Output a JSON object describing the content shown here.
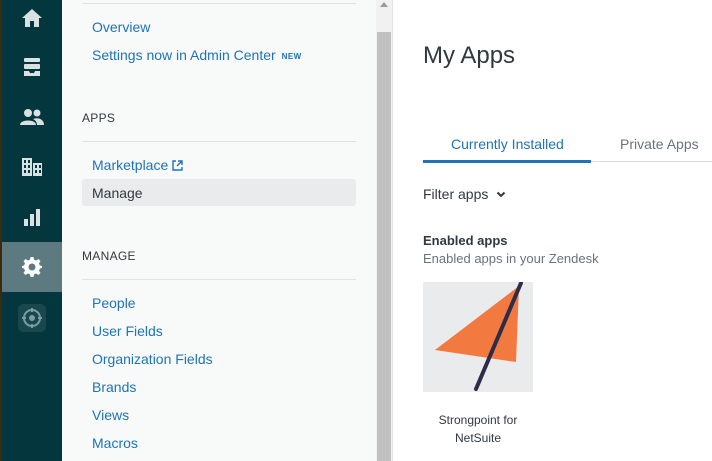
{
  "rail": {
    "items": [
      {
        "icon": "home-icon"
      },
      {
        "icon": "inbox-icon"
      },
      {
        "icon": "users-icon"
      },
      {
        "icon": "building-icon"
      },
      {
        "icon": "reports-icon"
      },
      {
        "icon": "gear-icon",
        "active": true
      },
      {
        "icon": "app-hub-icon"
      }
    ]
  },
  "sidebar": {
    "overview": "Overview",
    "settings_link": "Settings now in Admin Center",
    "settings_badge": "NEW",
    "apps_header": "APPS",
    "marketplace": "Marketplace",
    "manage_selected": "Manage",
    "manage_header": "MANAGE",
    "manage_items": [
      "People",
      "User Fields",
      "Organization Fields",
      "Brands",
      "Views",
      "Macros"
    ]
  },
  "main": {
    "title": "My Apps",
    "tabs": [
      {
        "label": "Currently Installed",
        "selected": true
      },
      {
        "label": "Private Apps",
        "selected": false
      }
    ],
    "filter_label": "Filter apps",
    "enabled_heading": "Enabled apps",
    "enabled_subheading": "Enabled apps in your Zendesk",
    "apps": [
      {
        "name_line1": "Strongpoint for",
        "name_line2": "NetSuite"
      }
    ]
  },
  "colors": {
    "rail_bg": "#03363d",
    "link": "#1f73b7",
    "logo_orange": "#f27a40",
    "logo_stroke": "#2d2d4a"
  }
}
